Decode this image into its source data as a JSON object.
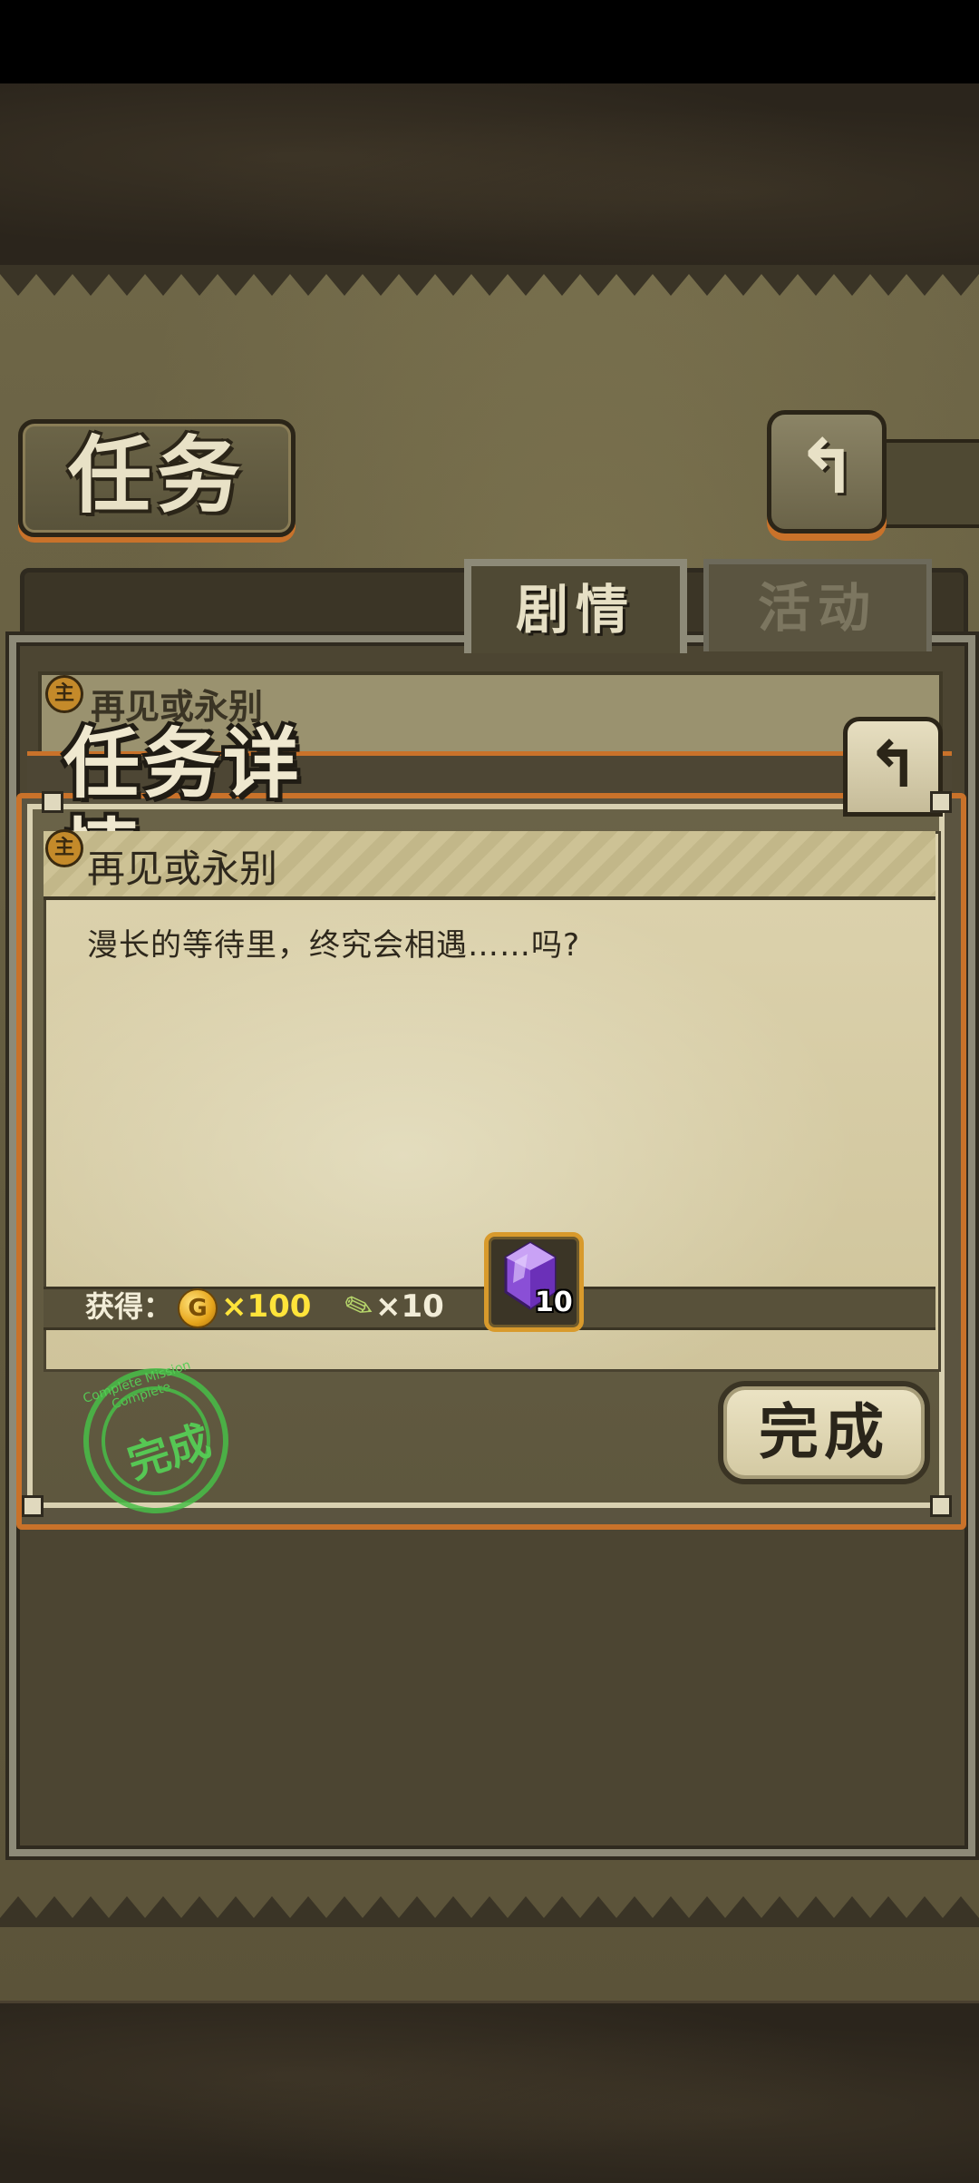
{
  "header": {
    "title": "任务",
    "back_icon": "↰"
  },
  "tabs": [
    {
      "label": "剧情",
      "active": true
    },
    {
      "label": "活动",
      "active": false
    }
  ],
  "list": {
    "first_item_badge": "主",
    "first_item_title": "再见或永别"
  },
  "dialog": {
    "title": "任务详情",
    "back_icon": "↰",
    "quest_badge": "主",
    "quest_name": "再见或永别",
    "description": "漫长的等待里，终究会相遇……吗?",
    "reward_label": "获得：",
    "rewards": {
      "coin_symbol": "G",
      "coin_qty": "×100",
      "feather_qty": "×10",
      "gem_qty": "10"
    },
    "stamp_text": "完成",
    "stamp_ring": "Complete Mission Complete",
    "complete_button": "完成"
  },
  "colors": {
    "accent_orange": "#c9722a",
    "coin_text": "#ffe43a",
    "stamp_green": "#48be48",
    "gem_purple": "#9b59e0"
  }
}
